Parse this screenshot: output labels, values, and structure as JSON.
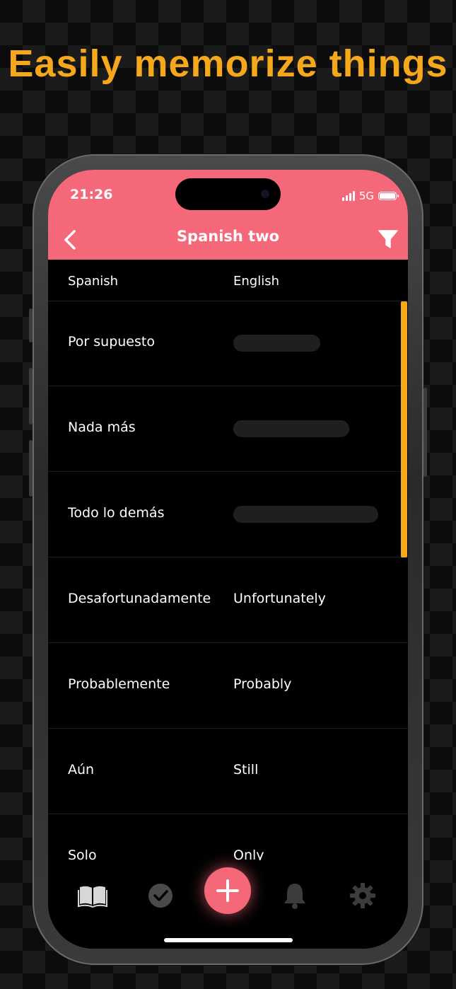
{
  "headline": "Easily memorize things",
  "status": {
    "time": "21:26",
    "network": "5G"
  },
  "nav": {
    "title": "Spanish two"
  },
  "columns": {
    "left": "Spanish",
    "right": "English"
  },
  "rows": [
    {
      "spanish": "Por supuesto",
      "english": "",
      "hidden": true
    },
    {
      "spanish": "Nada más",
      "english": "",
      "hidden": true
    },
    {
      "spanish": "Todo lo demás",
      "english": "",
      "hidden": true
    },
    {
      "spanish": "Desafortunadamente",
      "english": "Unfortunately",
      "hidden": false
    },
    {
      "spanish": "Probablemente",
      "english": "Probably",
      "hidden": false
    },
    {
      "spanish": "Aún",
      "english": "Still",
      "hidden": false
    },
    {
      "spanish": "Solo",
      "english": "Only",
      "hidden": false
    }
  ],
  "tabs": [
    "book-icon",
    "check-circle-icon",
    "plus-icon",
    "bell-icon",
    "gear-icon"
  ],
  "colors": {
    "accent": "#f4687a",
    "highlight": "#f6a81d",
    "background": "#000000"
  }
}
